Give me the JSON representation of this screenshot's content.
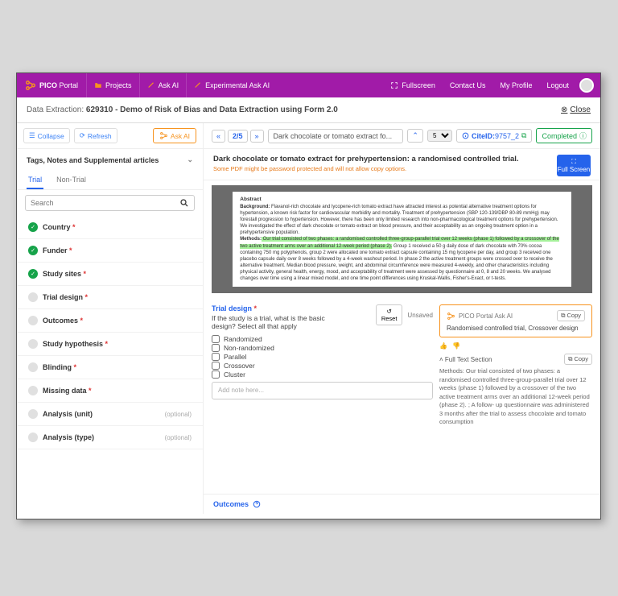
{
  "brand": {
    "name_bold": "PICO",
    "name_light": "Portal"
  },
  "topnav": {
    "projects": "Projects",
    "askai": "Ask AI",
    "exp": "Experimental Ask AI",
    "fullscreen": "Fullscreen",
    "contact": "Contact Us",
    "profile": "My Profile",
    "logout": "Logout"
  },
  "header": {
    "prefix": "Data Extraction: ",
    "title": "629310 - Demo of Risk of Bias and Data Extraction using Form 2.0",
    "close": "Close"
  },
  "left": {
    "collapse": "Collapse",
    "refresh": "Refresh",
    "askai": "Ask AI",
    "tags": "Tags, Notes and Supplemental articles",
    "tabs": {
      "trial": "Trial",
      "nontrial": "Non-Trial"
    },
    "search_placeholder": "Search",
    "sections": [
      {
        "label": "Country",
        "done": true,
        "required": true
      },
      {
        "label": "Funder",
        "done": true,
        "required": true
      },
      {
        "label": "Study sites",
        "done": true,
        "required": true
      },
      {
        "label": "Trial design",
        "done": false,
        "required": true
      },
      {
        "label": "Outcomes",
        "done": false,
        "required": true
      },
      {
        "label": "Study hypothesis",
        "done": false,
        "required": true
      },
      {
        "label": "Blinding",
        "done": false,
        "required": true
      },
      {
        "label": "Missing data",
        "done": false,
        "required": true
      },
      {
        "label": "Analysis (unit)",
        "done": false,
        "required": false,
        "optional": "(optional)"
      },
      {
        "label": "Analysis (type)",
        "done": false,
        "required": false,
        "optional": "(optional)"
      }
    ]
  },
  "toolbar": {
    "page": "2/5",
    "doc_title": "Dark chocolate or tomato extract fo...",
    "page_select": "5",
    "cite": "CiteID:",
    "cite_id": "9757_2",
    "status": "Completed"
  },
  "doc": {
    "title": "Dark chocolate or tomato extract for prehypertension: a randomised controlled trial.",
    "warn": "Some PDF might be password protected and will not allow copy options.",
    "full": "Full Screen",
    "abstract_label": "Abstract",
    "bg_label": "Background:",
    "bg": " Flavanol-rich chocolate and lycopene-rich tomato extract have attracted interest as potential alternative treatment options for hypertension, a known risk factor for cardiovascular morbidity and mortality. Treatment of prehypertension (SBP 120-139/DBP 80-89 mmHg) may forestall progression to hypertension. However, there has been only limited research into non-pharmacological treatment options for prehypertension. We investigated the effect of dark chocolate or tomato extract on blood pressure, and their acceptability as an ongoing treatment option in a prehypertensive population.",
    "me_label": "Methods:",
    "me_hl": " Our trial consisted of two phases: a randomised controlled three-group-parallel trial over 12 weeks (phase 1) followed by a crossover of the two active treatment arms over an additional 12-week period (phase 2).",
    "me_rest": " Group 1 received a 50 g daily dose of dark chocolate with 70% cocoa containing 750 mg polyphenols, group 2 were allocated one tomato extract capsule containing 15 mg lycopene per day, and group 3 received one placebo capsule daily over 8 weeks followed by a 4-week washout period. In phase 2 the active treatment groups were crossed over to receive the alternative treatment. Median blood pressure, weight, and abdominal circumference were measured 4-weekly, and other characteristics including physical activity, general health, energy, mood, and acceptability of treatment were assessed by questionnaire at 0, 8 and 20 weeks. We analysed changes over time using a linear mixed model, and one time point differences using Kruskal-Wallis, Fisher's-Exact, or t-tests."
  },
  "form": {
    "label": "Trial design",
    "question": "If the study is a trial, what is the basic design? Select all that apply",
    "reset": "Reset",
    "unsaved": "Unsaved",
    "options": [
      "Randomized",
      "Non-randomized",
      "Parallel",
      "Crossover",
      "Cluster"
    ],
    "note_ph": "Add note here..."
  },
  "ai": {
    "title": "PICO Portal Ask AI",
    "copy": "Copy",
    "answer": "Randomised controlled trial, Crossover design",
    "ft_label": "Full Text Section",
    "ft_text": "Methods: Our trial consisted of two phases: a randomised controlled three-group-parallel trial over 12 weeks (phase 1) followed by a crossover of the two active treatment arms over an additional 12-week period (phase 2). ; A follow- up questionnaire was administered 3 months after the trial to assess chocolate and tomato consumption"
  },
  "outcomes": {
    "label": "Outcomes"
  }
}
